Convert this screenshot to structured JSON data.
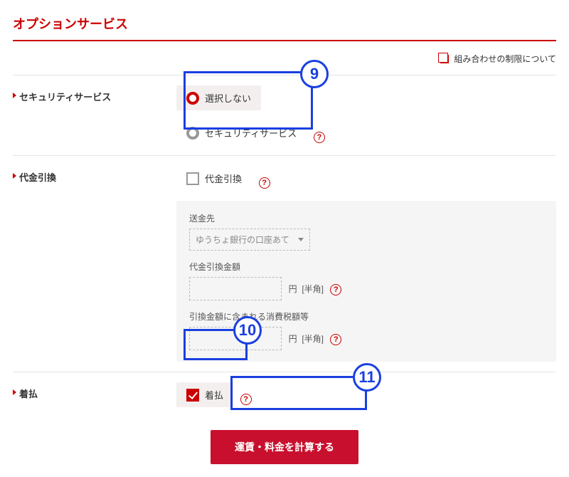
{
  "title": "オプションサービス",
  "top_link": "組み合わせの制限について",
  "security": {
    "label": "セキュリティサービス",
    "opt_none": "選択しない",
    "opt_security": "セキュリティサービス"
  },
  "cod": {
    "label": "代金引換",
    "checkbox_label": "代金引換",
    "dest_label": "送金先",
    "dest_value": "ゆうちょ銀行の口座あて",
    "amount_label": "代金引換金額",
    "tax_label": "引換金額に含まれる消費税額等",
    "unit": "円",
    "half_width": "[半角]"
  },
  "collect": {
    "label": "着払",
    "checkbox_label": "着払"
  },
  "calc_button": "運賃・料金を計算する",
  "annotations": {
    "n9": "9",
    "n10": "10",
    "n11": "11"
  }
}
